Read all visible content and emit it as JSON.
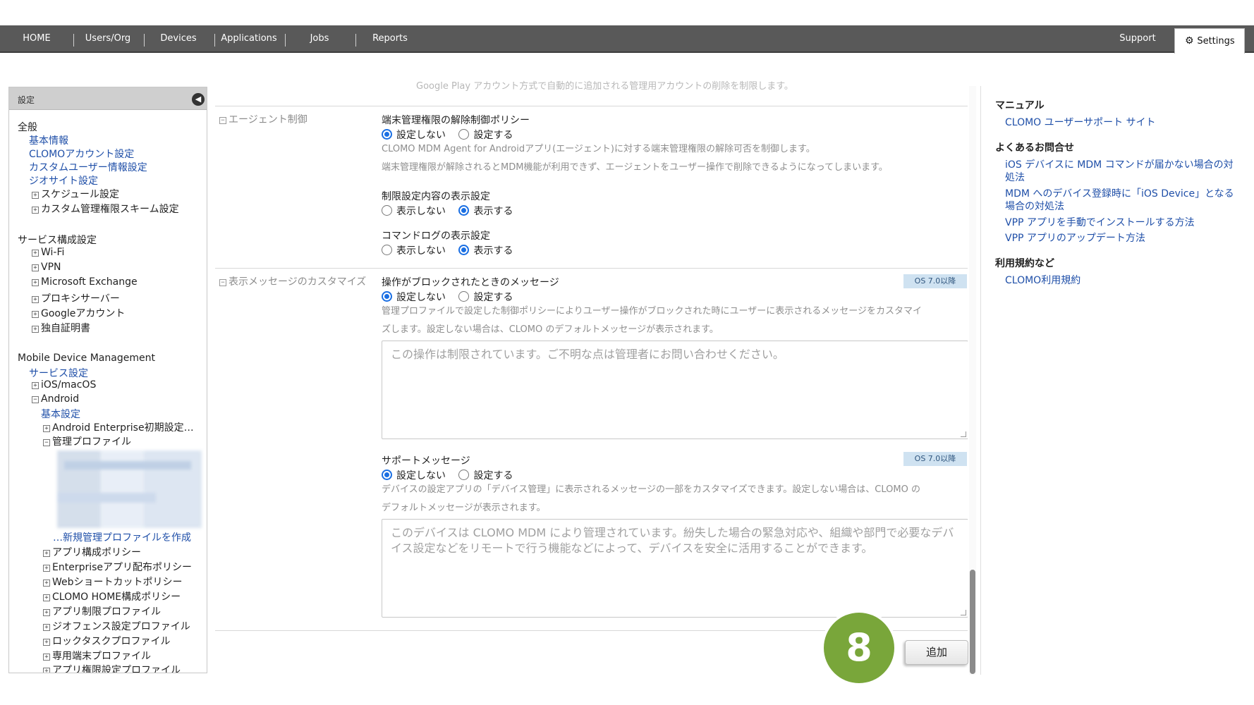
{
  "nav": {
    "items": [
      "HOME",
      "Users/Org",
      "Devices",
      "Applications",
      "Jobs",
      "Reports"
    ],
    "support": "Support",
    "settings": "Settings"
  },
  "sidebar": {
    "title": "設定",
    "general_heading": "全般",
    "general_links": [
      "基本情報",
      "CLOMOアカウント設定",
      "カスタムユーザー情報設定",
      "ジオサイト設定"
    ],
    "general_tree": [
      "スケジュール設定",
      "カスタム管理権限スキーム設定"
    ],
    "services_heading": "サービス構成設定",
    "services_tree": [
      "Wi-Fi",
      "VPN",
      "Microsoft Exchange",
      "プロキシサーバー",
      "Googleアカウント",
      "独自証明書"
    ],
    "mdm_heading": "Mobile Device Management",
    "mdm_link": "サービス設定",
    "ios": "iOS/macOS",
    "android": "Android",
    "android_basic": "基本設定",
    "android_enterprise": "Android Enterprise初期設定…",
    "managed_profile": "管理プロファイル",
    "new_profile": "…新規管理プロファイルを作成",
    "policies": [
      "アプリ構成ポリシー",
      "Enterpriseアプリ配布ポリシー",
      "Webショートカットポリシー",
      "CLOMO HOME構成ポリシー",
      "アプリ制限プロファイル",
      "ジオフェンス設定プロファイル",
      "ロックタスクプロファイル",
      "専用端末プロファイル",
      "アプリ権限設定プロファイル"
    ]
  },
  "main": {
    "faded_top": "Google Play アカウント方式で自動的に追加される管理用アカウントの削除を制限します。",
    "agent_section": {
      "label": "エージェント制御",
      "policy_title": "端末管理権限の解除制御ポリシー",
      "opt_off": "設定しない",
      "opt_on": "設定する",
      "desc1": "CLOMO MDM Agent for Androidアプリ(エージェント)に対する端末管理権限の解除可否を制御します。",
      "desc2": "端末管理権限が解除されるとMDM機能が利用できず、エージェントをユーザー操作で削除できるようになってしまいます。",
      "restrict_title": "制限設定内容の表示設定",
      "show_off": "表示しない",
      "show_on": "表示する",
      "cmdlog_title": "コマンドログの表示設定"
    },
    "message_section": {
      "label": "表示メッセージのカスタマイズ",
      "blocked_title": "操作がブロックされたときのメッセージ",
      "badge": "OS 7.0以降",
      "opt_off": "設定しない",
      "opt_on": "設定する",
      "blocked_desc1": "管理プロファイルで設定した制御ポリシーによりユーザー操作がブロックされた時にユーザーに表示されるメッセージをカスタマイ",
      "blocked_desc2": "ズします。設定しない場合は、CLOMO のデフォルトメッセージが表示されます。",
      "blocked_placeholder": "この操作は制限されています。ご不明な点は管理者にお問い合わせください。",
      "support_title": "サポートメッセージ",
      "support_desc1": "デバイスの設定アプリの「デバイス管理」に表示されるメッセージの一部をカスタマイズできます。設定しない場合は、CLOMO の",
      "support_desc2": "デフォルトメッセージが表示されます。",
      "support_placeholder": "このデバイスは CLOMO MDM により管理されています。紛失した場合の緊急対応や、組織や部門で必要なデバイス設定などをリモートで行う機能などによって、デバイスを安全に活用することができます。"
    },
    "add_button": "追加",
    "step_number": "8"
  },
  "right_panel": {
    "manual_heading": "マニュアル",
    "manual_link": "CLOMO ユーザーサポート サイト",
    "faq_heading": "よくあるお問合せ",
    "faq_links": [
      {
        "line1": "iOS デバイスに MDM コマンドが届かない場合の対",
        "line2": "処法"
      },
      {
        "line1": "MDM へのデバイス登録時に「iOS Device」となる",
        "line2": "場合の対処法"
      },
      {
        "line1": "VPP アプリを手動でインストールする方法",
        "line2": ""
      },
      {
        "line1": "VPP アプリのアップデート方法",
        "line2": ""
      }
    ],
    "terms_heading": "利用規約など",
    "terms_link": "CLOMO利用規約"
  },
  "colors": {
    "nav_bg": "#595959",
    "link": "#1f4fa8",
    "radio_selected": "#1a6fe3",
    "badge_bg": "#cfe2f1",
    "step_badge": "#79a63a"
  }
}
